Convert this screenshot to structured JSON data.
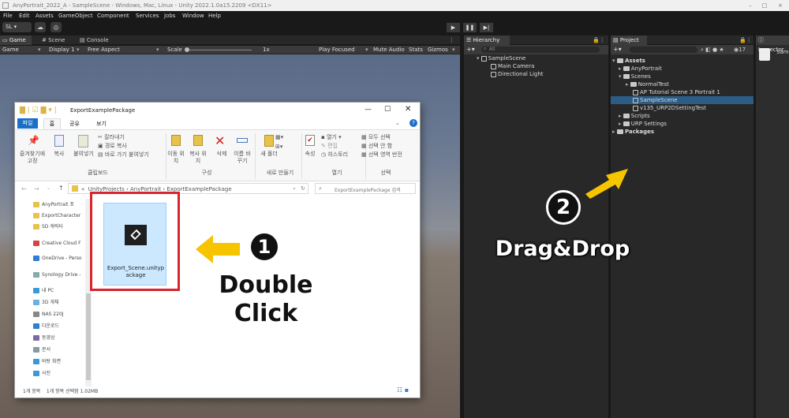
{
  "window": {
    "title": "AnyPortrait_2022_A - SampleScene - Windows, Mac, Linux - Unity 2022.1.0a15.2209 <DX11>"
  },
  "menu": [
    "File",
    "Edit",
    "Assets",
    "GameObject",
    "Component",
    "Services",
    "Jobs",
    "Window",
    "Help"
  ],
  "toolbar": {
    "account": "SL"
  },
  "game_panel": {
    "tabs": [
      "Game",
      "Scene",
      "Console"
    ],
    "bar": {
      "mode": "Game",
      "display": "Display 1",
      "aspect": "Free Aspect",
      "scale_label": "Scale",
      "scale_value": "1x",
      "play_focused": "Play Focused",
      "mute": "Mute Audio",
      "stats": "Stats",
      "gizmos": "Gizmos"
    }
  },
  "hierarchy": {
    "tab": "Hierarchy",
    "search_placeholder": "All",
    "scene": "SampleScene",
    "items": [
      "Main Camera",
      "Directional Light"
    ]
  },
  "project": {
    "tab": "Project",
    "count": "17",
    "tree": [
      "Assets",
      "AnyPortrait",
      "Scenes",
      "NormalTest",
      "AP Tutorial Scene 3 Portrait 1",
      "SampleScene",
      "v135_URP2DSettingTest",
      "Scripts",
      "URP Settings",
      "Packages"
    ]
  },
  "inspector": {
    "tab": "Inspector",
    "label": "Sam"
  },
  "explorer": {
    "title": "ExportExamplePackage",
    "ribbon_tabs": [
      "파일",
      "홈",
      "공유",
      "보기"
    ],
    "ribbon": {
      "pin": "즐겨찾기에 고정",
      "copy": "복사",
      "paste": "붙여넣기",
      "cut": "잘라내기",
      "copy_path": "경로 복사",
      "paste_shortcut": "바로 가기 붙여넣기",
      "clipboard": "클립보드",
      "move_to": "이동 위치",
      "copy_to": "복사 위치",
      "delete": "삭제",
      "rename": "이름 바꾸기",
      "organize": "구성",
      "new_folder": "새 폴더",
      "new": "새로 만들기",
      "properties": "속성",
      "open": "열기",
      "edit": "편집",
      "history": "히스토리",
      "open_group": "열기",
      "select_all": "모두 선택",
      "select_none": "선택 안 함",
      "invert": "선택 영역 반전",
      "select": "선택"
    },
    "path": [
      "UnityProjects",
      "AnyPortrait",
      "ExportExamplePackage"
    ],
    "search_placeholder": "ExportExamplePackage 검색",
    "nav": [
      "AnyPortrait 포",
      "ExportCharacter",
      "SD 캐릭터",
      "Creative Cloud F",
      "OneDrive - Perso",
      "Synology Drive -",
      "내 PC",
      "3D 개체",
      "NAS 220J",
      "다운로드",
      "동영상",
      "문서",
      "바탕 화면",
      "사진"
    ],
    "file": {
      "name": "Export_Scene.unitypackage"
    },
    "status": "1개 항목    1개 항목 선택함 1.02MB"
  },
  "annotations": {
    "step1": "1",
    "step1_label_1": "Double",
    "step1_label_2": "Click",
    "step2": "2",
    "step2_label": "Drag&Drop"
  },
  "colors": {
    "accent_yellow": "#f7c400",
    "select_blue": "#2c5d87",
    "red_box": "#d9232f"
  }
}
